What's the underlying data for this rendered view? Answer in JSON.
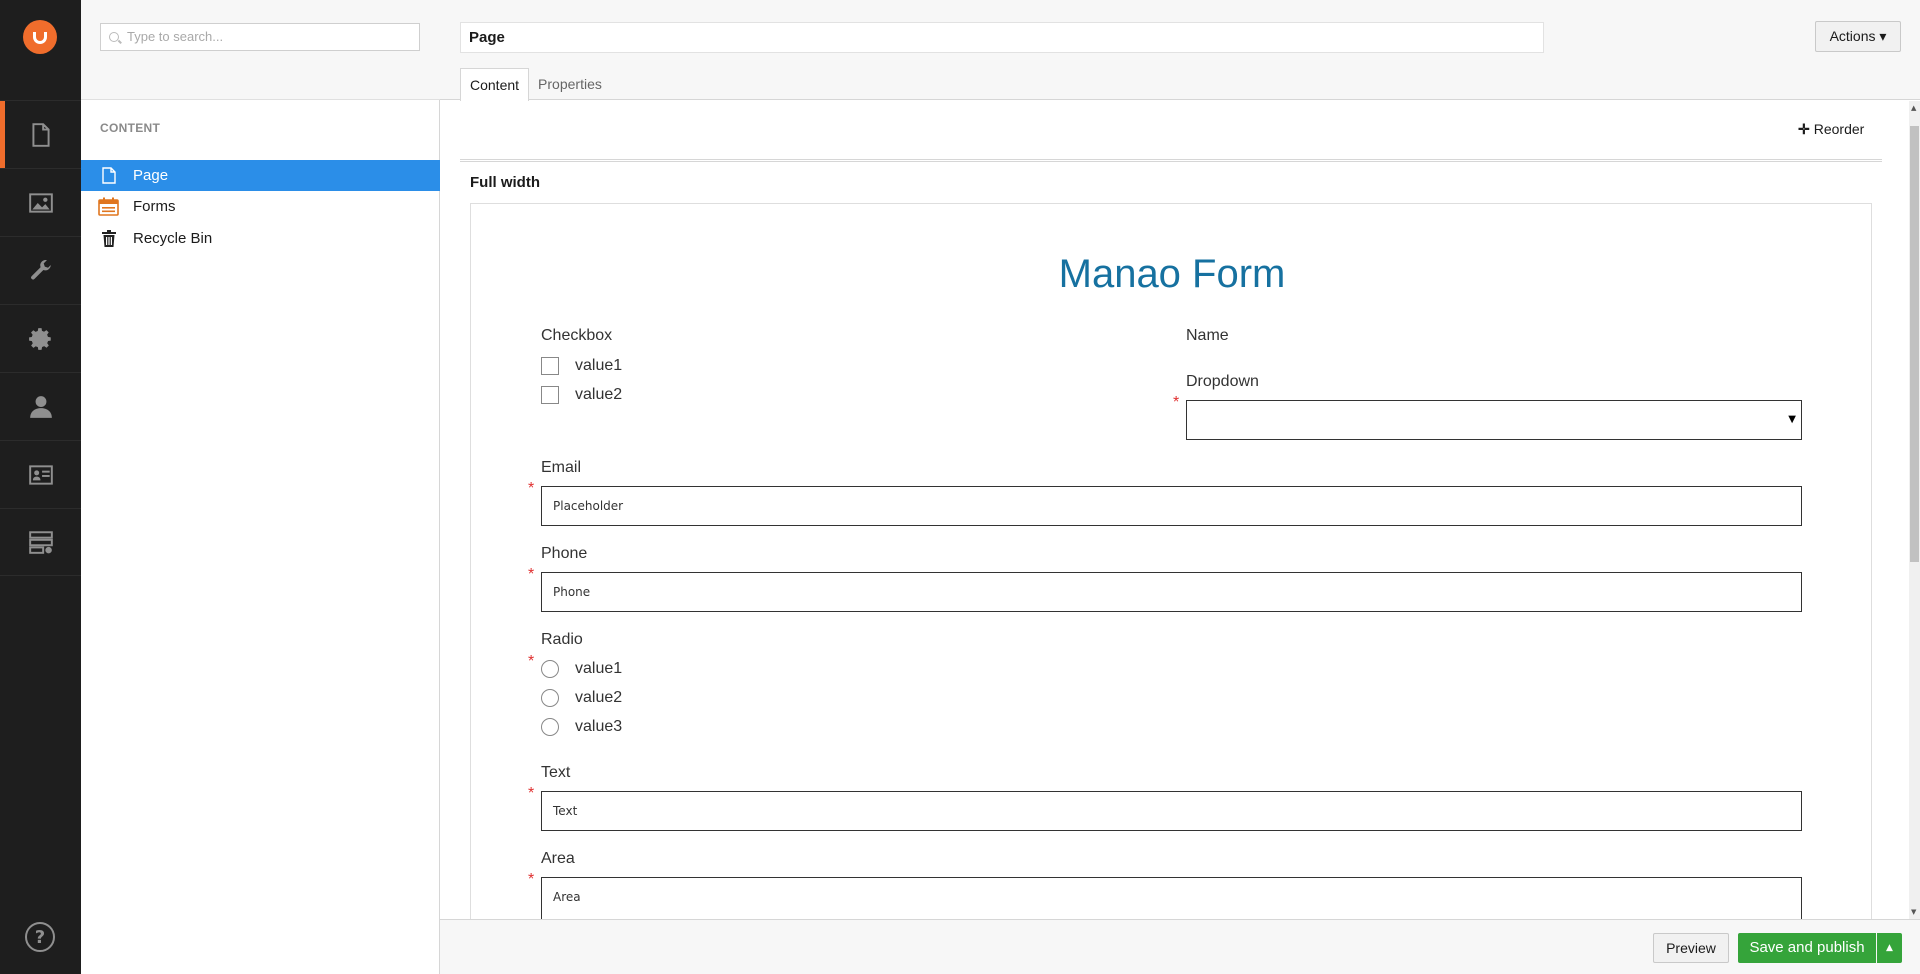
{
  "sections": [
    {
      "name": "content-section",
      "icon": "document-icon",
      "active": true
    },
    {
      "name": "media-section",
      "icon": "image-icon"
    },
    {
      "name": "settings-section",
      "icon": "wrench-icon"
    },
    {
      "name": "developer-section",
      "icon": "gear-icon"
    },
    {
      "name": "users-section",
      "icon": "user-icon"
    },
    {
      "name": "members-section",
      "icon": "id-card-icon"
    },
    {
      "name": "forms-section",
      "icon": "forms-icon"
    }
  ],
  "tree": {
    "search_placeholder": "Type to search...",
    "root_label": "CONTENT",
    "items": [
      {
        "label": "Page",
        "icon": "document-icon",
        "active": true
      },
      {
        "label": "Forms",
        "icon": "forms-icon"
      },
      {
        "label": "Recycle Bin",
        "icon": "trash-icon"
      }
    ]
  },
  "editor": {
    "name_value": "Page",
    "actions_label": "Actions ▾",
    "tabs": [
      {
        "label": "Content",
        "active": true
      },
      {
        "label": "Properties"
      }
    ],
    "reorder_label": "Reorder",
    "section_label": "Full width"
  },
  "form": {
    "title": "Manao Form",
    "checkbox": {
      "label": "Checkbox",
      "options": [
        "value1",
        "value2"
      ]
    },
    "name": {
      "label": "Name"
    },
    "dropdown": {
      "label": "Dropdown",
      "value": "",
      "required": true
    },
    "email": {
      "label": "Email",
      "placeholder": "Placeholder",
      "required": true
    },
    "phone": {
      "label": "Phone",
      "placeholder": "Phone",
      "required": true
    },
    "radio": {
      "label": "Radio",
      "options": [
        "value1",
        "value2",
        "value3"
      ],
      "required": true
    },
    "text": {
      "label": "Text",
      "placeholder": "Text",
      "required": true
    },
    "area": {
      "label": "Area",
      "placeholder": "Area",
      "required": true
    },
    "required_mark": "*"
  },
  "footer": {
    "preview_label": "Preview",
    "publish_label": "Save and publish"
  },
  "colors": {
    "accent": "#f06d2c",
    "selected": "#2b8ee8",
    "publish": "#35a43a",
    "form_title": "#1671a0",
    "required": "#e03030"
  }
}
